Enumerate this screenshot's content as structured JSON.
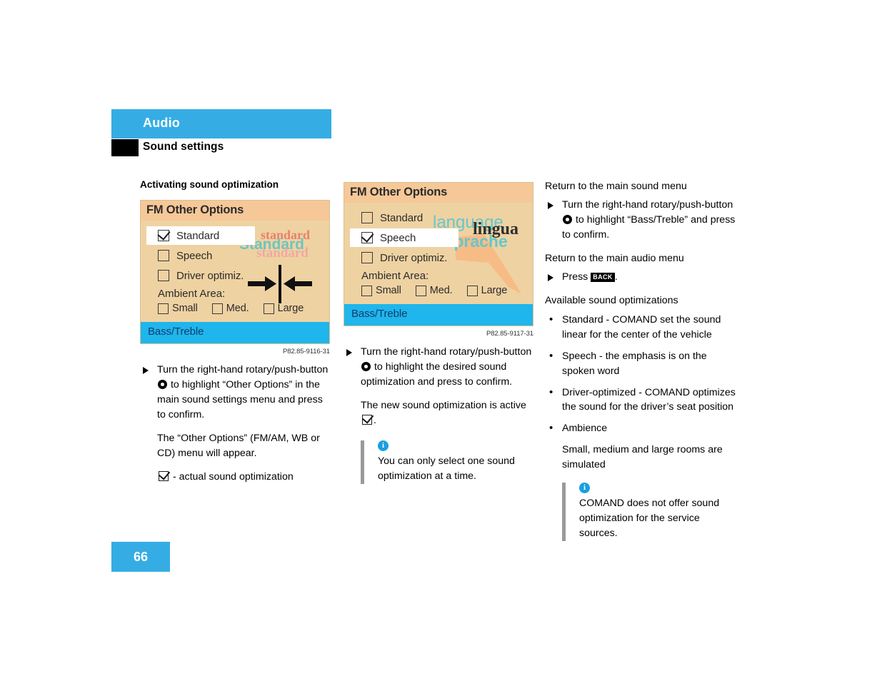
{
  "header": {
    "chapter": "Audio",
    "section": "Sound settings",
    "chapter_bar_color": "#35ade4",
    "section_marker_color": "#000000"
  },
  "page_number": "66",
  "left_column": {
    "heading": "Activating sound optimization",
    "figure": {
      "title": "FM Other Options",
      "titlebar_color": "#f6c898",
      "body_color": "#efd2a2",
      "footer_color": "#1eb6ec",
      "options": [
        {
          "label": "Standard",
          "checked": true,
          "selected": true
        },
        {
          "label": "Speech",
          "checked": false,
          "selected": false
        },
        {
          "label": "Driver optimiz.",
          "checked": false,
          "selected": false
        }
      ],
      "ambient_label": "Ambient Area:",
      "ambient_options": [
        {
          "label": "Small",
          "checked": false
        },
        {
          "label": "Med.",
          "checked": false
        },
        {
          "label": "Large",
          "checked": false
        }
      ],
      "footer": "Bass/Treble",
      "art_words": [
        {
          "text": "standard",
          "color": "#e8826a"
        },
        {
          "text": "Standard",
          "color": "#6fc4c0"
        },
        {
          "text": "standard",
          "color": "#f0a9a0"
        }
      ],
      "caption": "P82.85-9116-31"
    },
    "step1": {
      "part1": "Turn the right-hand rotary/push-button",
      "part2": "to highlight “Other Options” in the main sound settings menu and press to confirm."
    },
    "para1": "The “Other Options” (FM/AM, WB or CD) menu will appear.",
    "legend": "- actual sound optimization"
  },
  "mid_column": {
    "figure": {
      "title": "FM Other Options",
      "options": [
        {
          "label": "Standard",
          "checked": false,
          "selected": false
        },
        {
          "label": "Speech",
          "checked": true,
          "selected": true
        },
        {
          "label": "Driver optimiz.",
          "checked": false,
          "selected": false
        }
      ],
      "ambient_label": "Ambient Area:",
      "ambient_options": [
        {
          "label": "Small",
          "checked": false
        },
        {
          "label": "Med.",
          "checked": false
        },
        {
          "label": "Large",
          "checked": false
        }
      ],
      "footer": "Bass/Treble",
      "art_words": [
        {
          "text": "language",
          "color": "#67c6cd"
        },
        {
          "text": "lingua",
          "color": "#2f2f2f"
        },
        {
          "text": "Sprache",
          "color": "#67c6cd"
        }
      ],
      "caption": "P82.85-9117-31"
    },
    "step1": {
      "part1": "Turn the right-hand rotary/push-button",
      "part2": "to highlight the desired sound optimization and press to confirm."
    },
    "para1_before": "The new sound optimization is active",
    "para1_after": ".",
    "note": {
      "icon": "info-icon",
      "text": "You can only select one sound optimization at a time."
    }
  },
  "right_column": {
    "subheading1": "Return to the main sound menu",
    "step1": {
      "part1": "Turn the right-hand rotary/push-button",
      "part2": "to highlight “Bass/Treble” and press to confirm."
    },
    "subheading2": "Return to the main audio menu",
    "step2": {
      "before": "Press",
      "key": "BACK",
      "after": "."
    },
    "subheading3": "Available sound optimizations",
    "bullets": [
      {
        "text": "Standard - COMAND set the sound linear for the center of the vehicle",
        "bulleted": true
      },
      {
        "text": "Speech - the emphasis is on the spoken word",
        "bulleted": true
      },
      {
        "text": "Driver-optimized - COMAND optimizes the sound for the driver’s seat position",
        "bulleted": true
      },
      {
        "text": "Ambience",
        "bulleted": true
      },
      {
        "text": "Small, medium and large rooms are simulated",
        "bulleted": false
      }
    ],
    "note": {
      "icon": "info-icon",
      "text": "COMAND does not offer sound optimization for the service sources."
    }
  }
}
